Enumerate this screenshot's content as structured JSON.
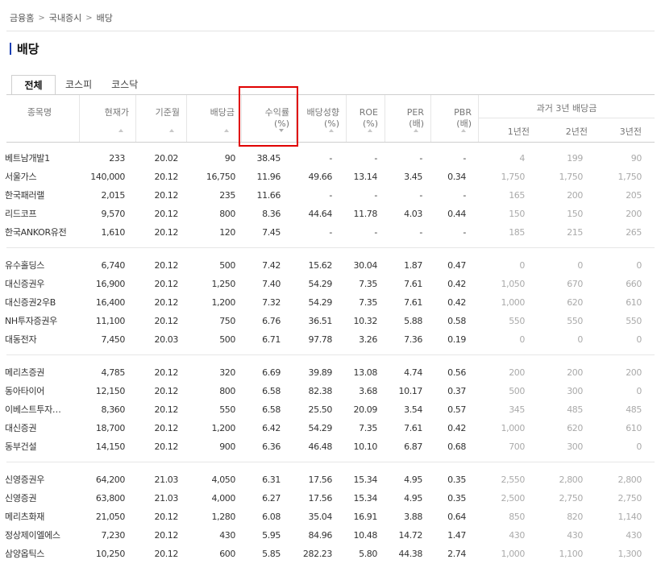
{
  "breadcrumb": [
    "금융홈",
    "국내증시",
    "배당"
  ],
  "page_title": "배당",
  "tabs": [
    {
      "label": "전체",
      "active": true
    },
    {
      "label": "코스피",
      "active": false
    },
    {
      "label": "코스닥",
      "active": false
    }
  ],
  "columns": [
    {
      "label": "종목명"
    },
    {
      "label": "현재가"
    },
    {
      "label": "기준월"
    },
    {
      "label": "배당금"
    },
    {
      "label": "수익률\n(%)",
      "sorted": "desc"
    },
    {
      "label": "배당성향\n(%)"
    },
    {
      "label": "ROE\n(%)"
    },
    {
      "label": "PER\n(배)"
    },
    {
      "label": "PBR\n(배)"
    }
  ],
  "history_header": {
    "label": "과거 3년 배당금",
    "subs": [
      "1년전",
      "2년전",
      "3년전"
    ]
  },
  "colors": {
    "accent": "#1a3fb5",
    "highlight": "#e00000"
  },
  "rows": [
    [
      "베트남개발1",
      "233",
      "20.02",
      "90",
      "38.45",
      "-",
      "-",
      "-",
      "-",
      "4",
      "199",
      "90"
    ],
    [
      "서울가스",
      "140,000",
      "20.12",
      "16,750",
      "11.96",
      "49.66",
      "13.14",
      "3.45",
      "0.34",
      "1,750",
      "1,750",
      "1,750"
    ],
    [
      "한국패러랠",
      "2,015",
      "20.12",
      "235",
      "11.66",
      "-",
      "-",
      "-",
      "-",
      "165",
      "200",
      "205"
    ],
    [
      "리드코프",
      "9,570",
      "20.12",
      "800",
      "8.36",
      "44.64",
      "11.78",
      "4.03",
      "0.44",
      "150",
      "150",
      "200"
    ],
    [
      "한국ANKOR유전",
      "1,610",
      "20.12",
      "120",
      "7.45",
      "-",
      "-",
      "-",
      "-",
      "185",
      "215",
      "265"
    ],
    [
      "유수홀딩스",
      "6,740",
      "20.12",
      "500",
      "7.42",
      "15.62",
      "30.04",
      "1.87",
      "0.47",
      "0",
      "0",
      "0"
    ],
    [
      "대신증권우",
      "16,900",
      "20.12",
      "1,250",
      "7.40",
      "54.29",
      "7.35",
      "7.61",
      "0.42",
      "1,050",
      "670",
      "660"
    ],
    [
      "대신증권2우B",
      "16,400",
      "20.12",
      "1,200",
      "7.32",
      "54.29",
      "7.35",
      "7.61",
      "0.42",
      "1,000",
      "620",
      "610"
    ],
    [
      "NH투자증권우",
      "11,100",
      "20.12",
      "750",
      "6.76",
      "36.51",
      "10.32",
      "5.88",
      "0.58",
      "550",
      "550",
      "550"
    ],
    [
      "대동전자",
      "7,450",
      "20.03",
      "500",
      "6.71",
      "97.78",
      "3.26",
      "7.36",
      "0.19",
      "0",
      "0",
      "0"
    ],
    [
      "메리츠증권",
      "4,785",
      "20.12",
      "320",
      "6.69",
      "39.89",
      "13.08",
      "4.74",
      "0.56",
      "200",
      "200",
      "200"
    ],
    [
      "동아타이어",
      "12,150",
      "20.12",
      "800",
      "6.58",
      "82.38",
      "3.68",
      "10.17",
      "0.37",
      "500",
      "300",
      "0"
    ],
    [
      "이베스트투자…",
      "8,360",
      "20.12",
      "550",
      "6.58",
      "25.50",
      "20.09",
      "3.54",
      "0.57",
      "345",
      "485",
      "485"
    ],
    [
      "대신증권",
      "18,700",
      "20.12",
      "1,200",
      "6.42",
      "54.29",
      "7.35",
      "7.61",
      "0.42",
      "1,000",
      "620",
      "610"
    ],
    [
      "동부건설",
      "14,150",
      "20.12",
      "900",
      "6.36",
      "46.48",
      "10.10",
      "6.87",
      "0.68",
      "700",
      "300",
      "0"
    ],
    [
      "신영증권우",
      "64,200",
      "21.03",
      "4,050",
      "6.31",
      "17.56",
      "15.34",
      "4.95",
      "0.35",
      "2,550",
      "2,800",
      "2,800"
    ],
    [
      "신영증권",
      "63,800",
      "21.03",
      "4,000",
      "6.27",
      "17.56",
      "15.34",
      "4.95",
      "0.35",
      "2,500",
      "2,750",
      "2,750"
    ],
    [
      "메리츠화재",
      "21,050",
      "20.12",
      "1,280",
      "6.08",
      "35.04",
      "16.91",
      "3.88",
      "0.64",
      "850",
      "820",
      "1,140"
    ],
    [
      "정상제이엘에스",
      "7,230",
      "20.12",
      "430",
      "5.95",
      "84.96",
      "10.48",
      "14.72",
      "1.47",
      "430",
      "430",
      "430"
    ],
    [
      "삼양옵틱스",
      "10,250",
      "20.12",
      "600",
      "5.85",
      "282.23",
      "5.80",
      "44.38",
      "2.74",
      "1,000",
      "1,100",
      "1,300"
    ]
  ]
}
